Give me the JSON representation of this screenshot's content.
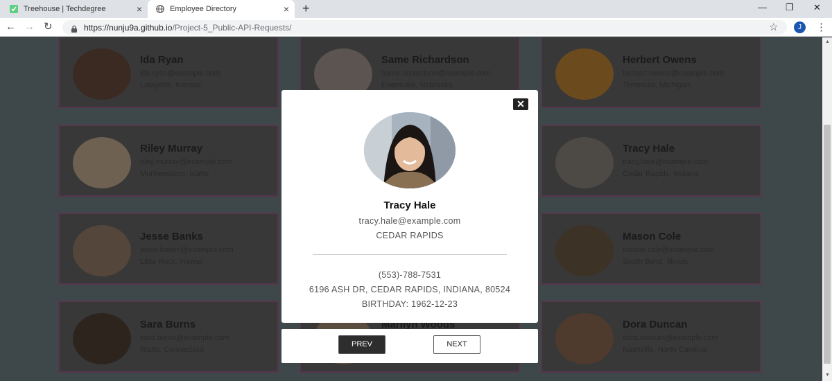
{
  "browser": {
    "tabs": [
      {
        "title": "Treehouse | Techdegree"
      },
      {
        "title": "Employee Directory"
      }
    ],
    "url_host": "https://nunju9a.github.io",
    "url_path": "/Project-5_Public-API-Requests/",
    "profile_initial": "J"
  },
  "cards": [
    {
      "name": "Ida Ryan",
      "email": "ida.ryan@example.com",
      "location": "Lafayette, Kansas"
    },
    {
      "name": "Same Richardson",
      "email": "same.richardson@example.com",
      "location": "Evansville, Nebraska"
    },
    {
      "name": "Herbert Owens",
      "email": "herbert.owens@example.com",
      "location": "Temecula, Michigan"
    },
    {
      "name": "Riley Murray",
      "email": "riley.murray@example.com",
      "location": "Murfreesboro, Idaho"
    },
    {
      "name": "Tracy Hale",
      "email": "tracy.hale@example.com",
      "location": "Cedar Rapids, Indiana"
    },
    {
      "name": "Jesse Banks",
      "email": "jesse.banks@example.com",
      "location": "Little Rock, Hawaii"
    },
    {
      "name": "Mason Cole",
      "email": "mason.cole@example.com",
      "location": "South Bend, Illinois"
    },
    {
      "name": "Sara Burns",
      "email": "sara.burns@example.com",
      "location": "Rialto, Connecticut"
    },
    {
      "name": "Marilyn Woods",
      "email": "",
      "location": ""
    },
    {
      "name": "Dora Duncan",
      "email": "dora.duncan@example.com",
      "location": "Nashville, North Carolina"
    }
  ],
  "modal": {
    "close_label": "✕",
    "name": "Tracy Hale",
    "email": "tracy.hale@example.com",
    "city": "CEDAR RAPIDS",
    "phone": "(553)-788-7531",
    "address": "6196 ASH DR, CEDAR RAPIDS, INDIANA, 80524",
    "birthday": "BIRTHDAY: 1962-12-23",
    "prev_label": "PREV",
    "next_label": "NEXT"
  }
}
